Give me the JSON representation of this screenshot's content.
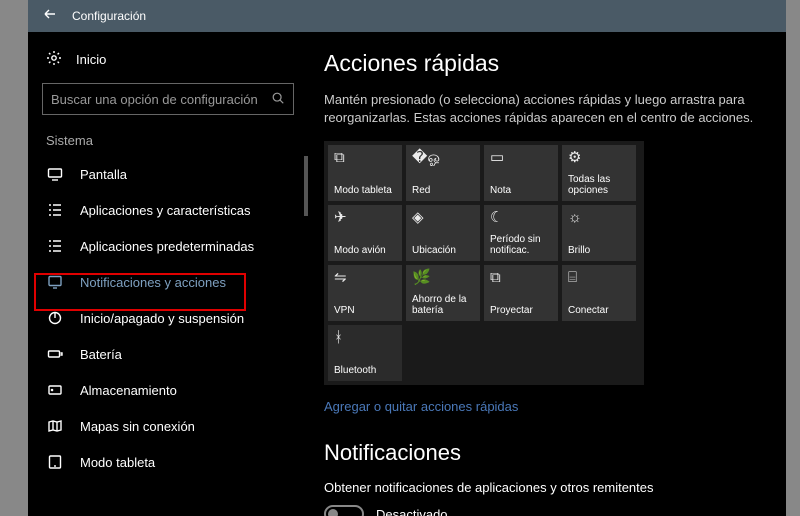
{
  "titlebar": {
    "title": "Configuración"
  },
  "sidebar": {
    "home": "Inicio",
    "search_placeholder": "Buscar una opción de configuración",
    "group": "Sistema",
    "items": [
      {
        "label": "Pantalla"
      },
      {
        "label": "Aplicaciones y características"
      },
      {
        "label": "Aplicaciones predeterminadas"
      },
      {
        "label": "Notificaciones y acciones",
        "selected": true
      },
      {
        "label": "Inicio/apagado y suspensión"
      },
      {
        "label": "Batería"
      },
      {
        "label": "Almacenamiento"
      },
      {
        "label": "Mapas sin conexión"
      },
      {
        "label": "Modo tableta"
      }
    ]
  },
  "main": {
    "heading": "Acciones rápidas",
    "desc": "Mantén presionado (o selecciona) acciones rápidas y luego arrastra para reorganizarlas. Estas acciones rápidas aparecen en el centro de acciones.",
    "tiles": [
      {
        "label": "Modo tableta"
      },
      {
        "label": "Red"
      },
      {
        "label": "Nota"
      },
      {
        "label": "Todas las opciones"
      },
      {
        "label": "Modo avión"
      },
      {
        "label": "Ubicación"
      },
      {
        "label": "Período sin notificac."
      },
      {
        "label": "Brillo"
      },
      {
        "label": "VPN"
      },
      {
        "label": "Ahorro de la batería"
      },
      {
        "label": "Proyectar"
      },
      {
        "label": "Conectar"
      },
      {
        "label": "Bluetooth"
      }
    ],
    "link": "Agregar o quitar acciones rápidas",
    "section2": "Notificaciones",
    "setting1": "Obtener notificaciones de aplicaciones y otros remitentes",
    "toggle_state": "Desactivado"
  }
}
